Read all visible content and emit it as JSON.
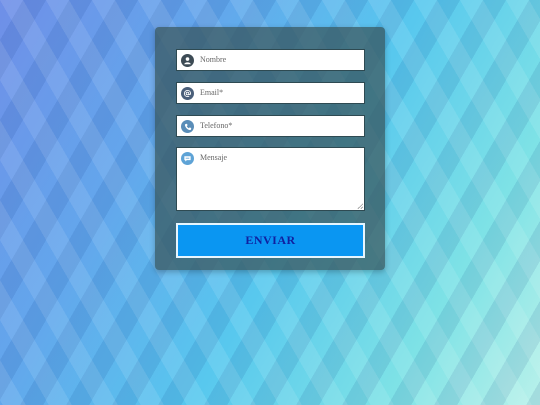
{
  "form": {
    "name_placeholder": "Nombre",
    "email_placeholder": "Email*",
    "phone_placeholder": "Telefono*",
    "message_placeholder": "Mensaje",
    "submit_label": "ENVIAR"
  },
  "icons": {
    "name": "user-icon",
    "email": "at-icon",
    "phone": "phone-icon",
    "message": "chat-bubble-icon"
  },
  "colors": {
    "submit_bg": "#0a96f2",
    "submit_text": "#1020a0",
    "icon_fill": "#4a7fb0"
  }
}
